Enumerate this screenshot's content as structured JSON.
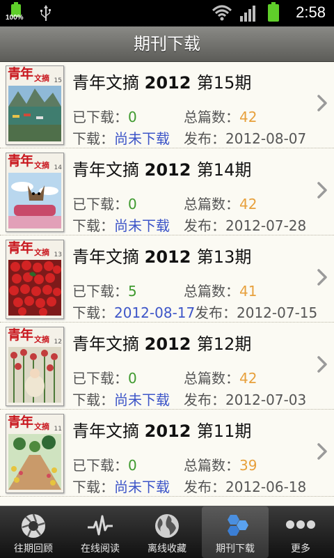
{
  "status_bar": {
    "battery_percent": "100%",
    "time": "2:58"
  },
  "header": {
    "title": "期刊下载"
  },
  "labels": {
    "downloaded": "已下载：",
    "total": "总篇数：",
    "download": "下载：",
    "published": "发布："
  },
  "issues": [
    {
      "magazine": "青年文摘",
      "year": "2012",
      "issue": "第15期",
      "downloaded": "0",
      "total": "42",
      "download_status": "尚未下载",
      "published": "2012-08-07",
      "cover_num": "15"
    },
    {
      "magazine": "青年文摘",
      "year": "2012",
      "issue": "第14期",
      "downloaded": "0",
      "total": "42",
      "download_status": "尚未下载",
      "published": "2012-07-28",
      "cover_num": "14"
    },
    {
      "magazine": "青年文摘",
      "year": "2012",
      "issue": "第13期",
      "downloaded": "5",
      "total": "41",
      "download_status": "2012-08-17",
      "published": "2012-07-15",
      "cover_num": "13"
    },
    {
      "magazine": "青年文摘",
      "year": "2012",
      "issue": "第12期",
      "downloaded": "0",
      "total": "42",
      "download_status": "尚未下载",
      "published": "2012-07-03",
      "cover_num": "12"
    },
    {
      "magazine": "青年文摘",
      "year": "2012",
      "issue": "第11期",
      "downloaded": "0",
      "total": "39",
      "download_status": "尚未下载",
      "published": "2012-06-18",
      "cover_num": "11"
    }
  ],
  "cover": {
    "title": "青年",
    "subtitle": "文摘"
  },
  "tabs": [
    {
      "label": "往期回顾",
      "icon": "aperture-icon"
    },
    {
      "label": "在线阅读",
      "icon": "pulse-icon"
    },
    {
      "label": "离线收藏",
      "icon": "globe-icon"
    },
    {
      "label": "期刊下载",
      "icon": "hexagons-icon",
      "active": true
    },
    {
      "label": "更多",
      "icon": "more-dots-icon"
    }
  ],
  "colors": {
    "value_green": "#3f9a2f",
    "value_orange": "#e7a03c",
    "value_blue": "#3d55c8",
    "cover_red": "#c8171e"
  }
}
